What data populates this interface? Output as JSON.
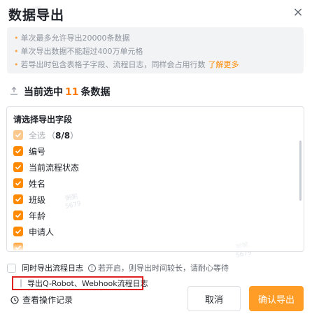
{
  "dialog": {
    "title": "数据导出",
    "close_glyph": "×"
  },
  "notice": {
    "lines": [
      "单次最多允许导出20000条数据",
      "单次导出数据不能超过400万单元格",
      "若导出时包含表格子字段、流程日志，同样会占用行数"
    ],
    "learn_more": "了解更多",
    "bullet": "•"
  },
  "selection": {
    "prefix": "当前选中",
    "count": "11",
    "suffix": "条数据"
  },
  "fields": {
    "title": "请选择导出字段",
    "select_all_label": "全选",
    "select_all_count_open": "（",
    "select_all_count": "8/8",
    "select_all_count_close": "）",
    "items": [
      "编号",
      "当前流程状态",
      "姓名",
      "班级",
      "年龄",
      "申请人"
    ]
  },
  "flow_log": {
    "label": "同时导出流程日志",
    "info_glyph": "!",
    "hint": "若开启，则导出时间较长，请耐心等待"
  },
  "robot_log": {
    "label": "导出Q-Robot、Webhook流程日志"
  },
  "history": {
    "label": "查看操作记录"
  },
  "buttons": {
    "cancel": "取消",
    "confirm": "确认导出"
  },
  "watermark": {
    "name": "粥粥",
    "id": "5679"
  },
  "colors": {
    "accent": "#ff8a00",
    "confirm_bg": "#ff9d26",
    "highlight_border": "#e02020"
  },
  "icons": {
    "close": "close-icon",
    "upload": "upload-icon",
    "checkbox_checked": "checkmark-icon",
    "info": "info-icon",
    "history": "history-icon"
  }
}
